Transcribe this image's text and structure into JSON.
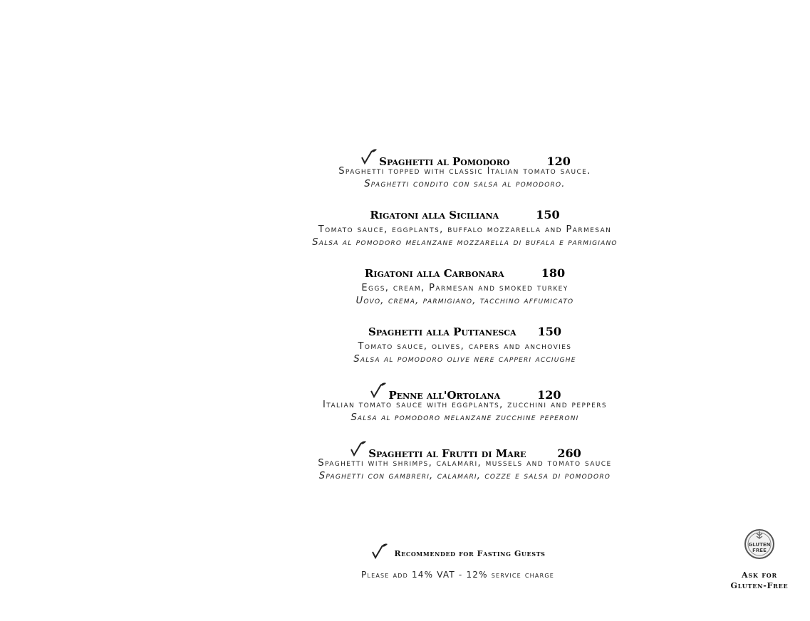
{
  "menu": {
    "items": [
      {
        "name": "Spaghetti al Pomodoro",
        "price": "120",
        "fasting": true,
        "desc_en": "Spaghetti topped with classic Italian tomato sauce.",
        "desc_it": "Spaghetti condito con salsa al pomodoro."
      },
      {
        "name": "Rigatoni alla Siciliana",
        "price": "150",
        "fasting": false,
        "desc_en": "Tomato sauce, eggplants, buffalo mozzarella and Parmesan",
        "desc_it": "Salsa al pomodoro melanzane mozzarella di bufala e parmigiano"
      },
      {
        "name": "Rigatoni alla Carbonara",
        "price": "180",
        "fasting": false,
        "desc_en": "Eggs, cream, Parmesan and smoked turkey",
        "desc_it": "Uovo, crema, parmigiano, tacchino affumicato"
      },
      {
        "name": "Spaghetti alla Puttanesca",
        "price": "150",
        "fasting": false,
        "desc_en": "Tomato sauce, olives, capers and anchovies",
        "desc_it": "Salsa al pomodoro olive nere capperi acciughe"
      },
      {
        "name": "Penne all'Ortolana",
        "price": "120",
        "fasting": true,
        "desc_en": "Italian tomato sauce with eggplants, zucchini and peppers",
        "desc_it": "Salsa al pomodoro melanzane zucchine peperoni"
      },
      {
        "name": "Spaghetti al Frutti di Mare",
        "price": "260",
        "fasting": true,
        "desc_en": "Spaghetti with shrimps, calamari, mussels and tomato sauce",
        "desc_it": "Spaghetti con gambreri, calamari, cozze e salsa di pomodoro"
      }
    ]
  },
  "footer": {
    "legend_icon": "fasting-leaf-icon",
    "legend_text": "Recommended for Fasting Guests",
    "vat_note": "Please add 14% VAT - 12% service charge"
  },
  "gluten_free": {
    "badge_text_top": "GLUTEN",
    "badge_text_bottom": "FREE",
    "line1": "Ask for",
    "line2": "Gluten-Free"
  }
}
